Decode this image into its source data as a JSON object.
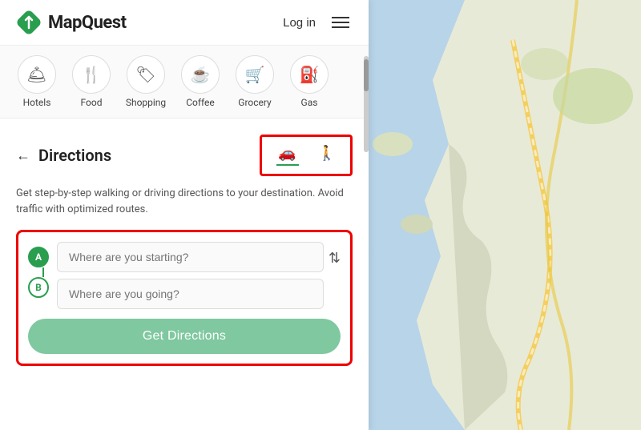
{
  "header": {
    "logo_text": "MapQuest",
    "login_label": "Log in",
    "menu_label": "Menu"
  },
  "categories": [
    {
      "id": "hotels",
      "label": "Hotels",
      "icon": "🛎"
    },
    {
      "id": "food",
      "label": "Food",
      "icon": "🍴"
    },
    {
      "id": "shopping",
      "label": "Shopping",
      "icon": "🏷"
    },
    {
      "id": "coffee",
      "label": "Coffee",
      "icon": "☕"
    },
    {
      "id": "grocery",
      "label": "Grocery",
      "icon": "🛒"
    },
    {
      "id": "gas",
      "label": "Gas",
      "icon": "⛽"
    }
  ],
  "directions": {
    "title": "Directions",
    "back_label": "←",
    "description": "Get step-by-step walking or driving directions to your destination. Avoid traffic with optimized routes.",
    "mode_car_label": "Car",
    "mode_walk_label": "Walk",
    "starting_placeholder": "Where are you starting?",
    "going_placeholder": "Where are you going?",
    "get_directions_label": "Get Directions",
    "swap_label": "⇅",
    "waypoint_a": "A",
    "waypoint_b": "B"
  },
  "colors": {
    "brand_green": "#2a9e4f",
    "highlight_red": "#e00000",
    "button_green_light": "#7fc8a0"
  }
}
